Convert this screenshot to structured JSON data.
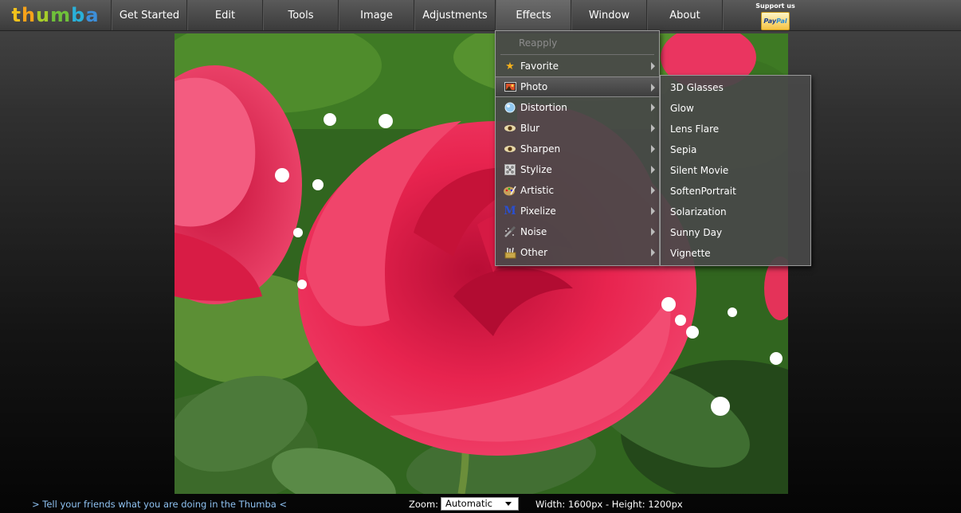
{
  "app": {
    "logo_letters": [
      "t",
      "h",
      "u",
      "m",
      "b",
      "a"
    ]
  },
  "menubar": {
    "items": [
      {
        "label": "Get Started"
      },
      {
        "label": "Edit"
      },
      {
        "label": "Tools"
      },
      {
        "label": "Image"
      },
      {
        "label": "Adjustments"
      },
      {
        "label": "Effects"
      },
      {
        "label": "Window"
      },
      {
        "label": "About"
      }
    ],
    "active": "Effects",
    "support_label": "Support us",
    "paypal_pay": "Pay",
    "paypal_pal": "Pal"
  },
  "effects_menu": {
    "reapply": "Reapply",
    "items": [
      {
        "label": "Favorite",
        "icon": "star-icon"
      },
      {
        "label": "Photo",
        "icon": "photo-icon"
      },
      {
        "label": "Distortion",
        "icon": "globe-icon"
      },
      {
        "label": "Blur",
        "icon": "eye-icon"
      },
      {
        "label": "Sharpen",
        "icon": "eye-icon"
      },
      {
        "label": "Stylize",
        "icon": "stylize-icon"
      },
      {
        "label": "Artistic",
        "icon": "palette-icon"
      },
      {
        "label": "Pixelize",
        "icon": "pixelize-icon"
      },
      {
        "label": "Noise",
        "icon": "noise-icon"
      },
      {
        "label": "Other",
        "icon": "tools-icon"
      }
    ],
    "highlighted": "Photo"
  },
  "photo_submenu": {
    "items": [
      "3D Glasses",
      "Glow",
      "Lens Flare",
      "Sepia",
      "Silent Movie",
      "SoftenPortrait",
      "Solarization",
      "Sunny Day",
      "Vignette"
    ]
  },
  "statusbar": {
    "tell_friends": "> Tell your friends what you are doing in the Thumba <",
    "zoom_label": "Zoom:",
    "zoom_value": "Automatic",
    "dimensions": "Width: 1600px - Height: 1200px"
  },
  "colors": {
    "link": "#8fc2f2",
    "menu_bg": "#484848",
    "rose": "#e0234f"
  }
}
